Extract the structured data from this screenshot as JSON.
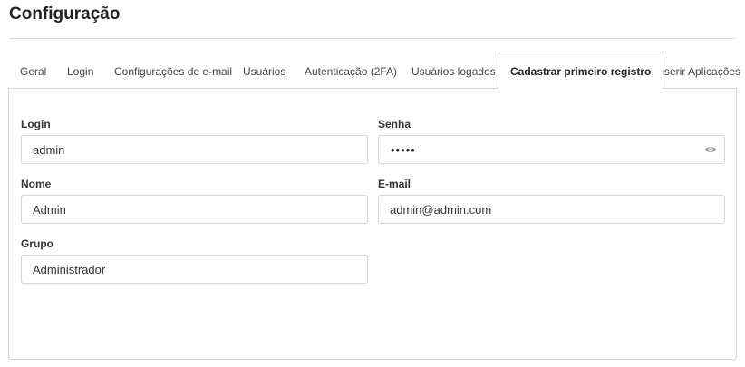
{
  "page": {
    "title": "Configuração"
  },
  "tabs": [
    {
      "label": "Geral",
      "active": false
    },
    {
      "label": "Login",
      "active": false
    },
    {
      "label": "Configurações de e-mail",
      "active": false
    },
    {
      "label": "Usuários",
      "active": false
    },
    {
      "label": "Autenticação (2FA)",
      "active": false
    },
    {
      "label": "Usuários logados",
      "active": false
    },
    {
      "label": "Cadastrar primeiro registro",
      "active": true
    },
    {
      "label": "Inserir Aplicações",
      "active": false
    }
  ],
  "form": {
    "login": {
      "label": "Login",
      "value": "admin"
    },
    "senha": {
      "label": "Senha",
      "masked": "•••••",
      "icon": "eye-icon"
    },
    "nome": {
      "label": "Nome",
      "value": "Admin"
    },
    "email": {
      "label": "E-mail",
      "value": "admin@admin.com"
    },
    "grupo": {
      "label": "Grupo",
      "value": "Administrador"
    }
  }
}
